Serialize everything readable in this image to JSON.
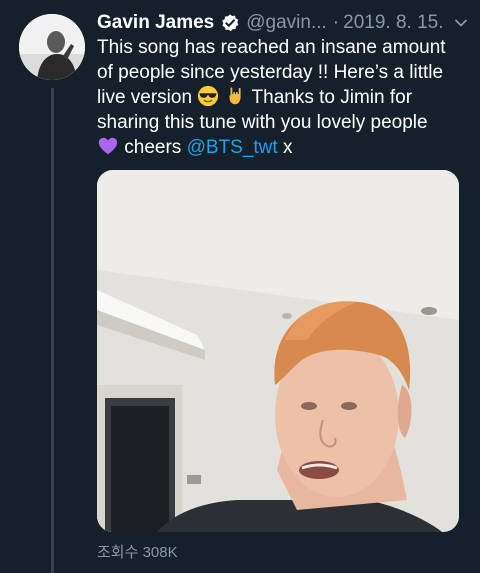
{
  "author": {
    "name": "Gavin James",
    "handle": "@gavin...",
    "separator": "·",
    "date": "2019. 8. 15."
  },
  "tweet": {
    "lines": [
      "This song has reached an insane amount",
      "of people since yesterday !! Here’s a little",
      "live version",
      "Thanks to Jimin for",
      "sharing this tune with you lovely people",
      "cheers",
      "@BTS_twt",
      "x"
    ],
    "emojis": [
      "sunglasses-emoji",
      "rock-on-hand-emoji",
      "purple-heart-emoji"
    ]
  },
  "stats": {
    "views": "조회수 308K"
  },
  "colors": {
    "background": "#15202b",
    "text": "#ffffff",
    "secondary": "#8899a6",
    "link": "#1da1f2",
    "verified": "#1da1f2",
    "thread": "#38444d"
  },
  "icons": [
    "verified-badge-icon",
    "chevron-down-icon"
  ]
}
